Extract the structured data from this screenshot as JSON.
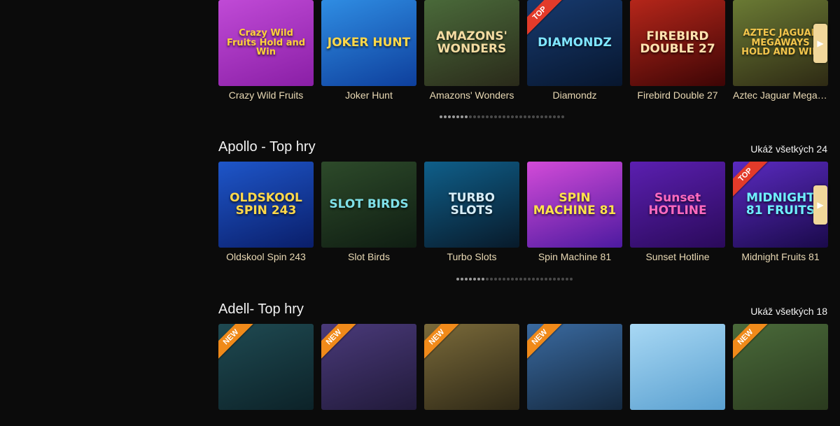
{
  "sections": [
    {
      "title": "",
      "link": "",
      "games": [
        {
          "name": "Crazy Wild Fruits",
          "art": "Crazy Wild Fruits Hold and Win",
          "bg": "linear-gradient(160deg,#c04ad6,#8a1fa6)",
          "fg": "#ffd23a",
          "ribbon": ""
        },
        {
          "name": "Joker Hunt",
          "art": "JOKER HUNT",
          "bg": "linear-gradient(160deg,#2f8de3,#0e3f9c)",
          "fg": "#ffd84a",
          "ribbon": ""
        },
        {
          "name": "Amazons' Wonders",
          "art": "AMAZONS' WONDERS",
          "bg": "linear-gradient(160deg,#4a6a3a,#2a2a1a)",
          "fg": "#f4dca2",
          "ribbon": ""
        },
        {
          "name": "Diamondz",
          "art": "DIAMONDZ",
          "bg": "linear-gradient(160deg,#173a6e,#07162e)",
          "fg": "#7fe6ff",
          "ribbon": "TOP"
        },
        {
          "name": "Firebird Double 27",
          "art": "FIREBIRD DOUBLE 27",
          "bg": "linear-gradient(160deg,#b5261a,#3d0505)",
          "fg": "#ffe3b0",
          "ribbon": ""
        },
        {
          "name": "Aztec Jaguar Megaways",
          "art": "AZTEC JAGUAR MEGAWAYS HOLD AND WIN",
          "bg": "linear-gradient(160deg,#6a7a34,#2e2a14)",
          "fg": "#f3c54c",
          "ribbon": ""
        }
      ],
      "pager": {
        "active": 7,
        "total": 30
      }
    },
    {
      "title": "Apollo - Top hry",
      "link": "Ukáž všetkých 24",
      "games": [
        {
          "name": "Oldskool Spin 243",
          "art": "OLDSKOOL SPIN 243",
          "bg": "linear-gradient(160deg,#1e56c9,#0a1e6a)",
          "fg": "#ffd84a",
          "ribbon": ""
        },
        {
          "name": "Slot Birds",
          "art": "SLOT BIRDS",
          "bg": "linear-gradient(160deg,#2d4a2a,#0f1d12)",
          "fg": "#7fe0e8",
          "ribbon": ""
        },
        {
          "name": "Turbo Slots",
          "art": "TURBO SLOTS",
          "bg": "linear-gradient(160deg,#0f5f8a,#081a2a)",
          "fg": "#d8eef8",
          "ribbon": ""
        },
        {
          "name": "Spin Machine 81",
          "art": "SPIN MACHINE 81",
          "bg": "linear-gradient(160deg,#d34bd8,#4d1aa0)",
          "fg": "#ffe34a",
          "ribbon": ""
        },
        {
          "name": "Sunset Hotline",
          "art": "Sunset HOTLINE",
          "bg": "linear-gradient(160deg,#5b1fb0,#2a0a5a)",
          "fg": "#ff6ac0",
          "ribbon": ""
        },
        {
          "name": "Midnight Fruits 81",
          "art": "MIDNIGHT 81 FRUITS",
          "bg": "linear-gradient(160deg,#5a2ac0,#1a0a4a)",
          "fg": "#6ff0ff",
          "ribbon": "TOP"
        }
      ],
      "pager": {
        "active": 7,
        "total": 28
      }
    },
    {
      "title": "Adell- Top hry",
      "link": "Ukáž všetkých 18",
      "games": [
        {
          "name": "",
          "art": "",
          "bg": "linear-gradient(160deg,#1f4a52,#0c2228)",
          "fg": "#ffffff",
          "ribbon": "NEW"
        },
        {
          "name": "",
          "art": "",
          "bg": "linear-gradient(160deg,#4a3a7a,#211a3a)",
          "fg": "#ffffff",
          "ribbon": "NEW"
        },
        {
          "name": "",
          "art": "",
          "bg": "linear-gradient(160deg,#7a6a3a,#2e2816)",
          "fg": "#ffffff",
          "ribbon": "NEW"
        },
        {
          "name": "",
          "art": "",
          "bg": "linear-gradient(160deg,#3a6aa0,#14283e)",
          "fg": "#ffffff",
          "ribbon": "NEW"
        },
        {
          "name": "",
          "art": "",
          "bg": "linear-gradient(160deg,#a8d8f4,#5aa0d0)",
          "fg": "#ffffff",
          "ribbon": ""
        },
        {
          "name": "",
          "art": "",
          "bg": "linear-gradient(160deg,#4a6a3a,#2a3a1e)",
          "fg": "#ffffff",
          "ribbon": "NEW"
        }
      ],
      "pager": {
        "active": 0,
        "total": 0
      }
    }
  ],
  "icons": {
    "next_arrow": "chevron-right-icon"
  },
  "colors": {
    "background": "#0b0b0b",
    "caption": "#e9d9b4",
    "arrow": "#f1d79a",
    "ribbon_top": "#e33b2a",
    "ribbon_new": "#f08a1a"
  }
}
